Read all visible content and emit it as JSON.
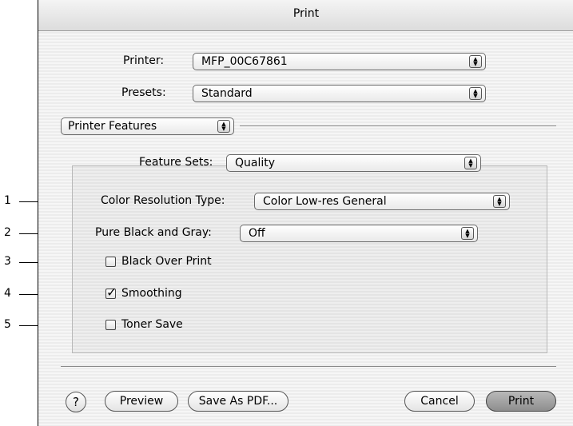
{
  "window": {
    "title": "Print"
  },
  "printer": {
    "label": "Printer:",
    "value": "MFP_00C67861"
  },
  "presets": {
    "label": "Presets:",
    "value": "Standard"
  },
  "panel_menu": {
    "value": "Printer Features"
  },
  "feature_sets": {
    "label": "Feature Sets:",
    "value": "Quality"
  },
  "color_resolution": {
    "label": "Color Resolution Type:",
    "value": "Color Low-res General"
  },
  "pure_black": {
    "label": "Pure Black and Gray:",
    "value": "Off"
  },
  "checkboxes": [
    {
      "label": "Black Over Print",
      "checked": false
    },
    {
      "label": "Smoothing",
      "checked": true
    },
    {
      "label": "Toner Save",
      "checked": false
    }
  ],
  "buttons": {
    "help": "?",
    "preview": "Preview",
    "save_pdf": "Save As PDF...",
    "cancel": "Cancel",
    "print": "Print"
  },
  "callouts": [
    "1",
    "2",
    "3",
    "4",
    "5"
  ],
  "glyphs": {
    "stepper": "▲\n▼",
    "check": "✓"
  }
}
